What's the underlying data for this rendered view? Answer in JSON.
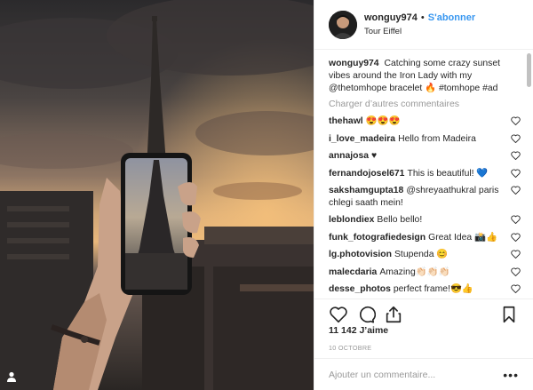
{
  "header": {
    "username": "wonguy974",
    "separator": "•",
    "follow_label": "S'abonner",
    "location": "Tour Eiffel"
  },
  "caption": {
    "username": "wonguy974",
    "text": "Catching some crazy sunset vibes around the Iron Lady with my @thetomhope bracelet 🔥 #tomhope #ad"
  },
  "load_more_label": "Charger d’autres commentaires",
  "comments": [
    {
      "username": "thehawl",
      "text": "😍😍😍"
    },
    {
      "username": "i_love_madeira",
      "text": "Hello from Madeira"
    },
    {
      "username": "annajosa",
      "text": "♥"
    },
    {
      "username": "fernandojosel671",
      "text": "This is beautiful! 💙"
    },
    {
      "username": "sakshamgupta18",
      "text": "@shreyaathukral paris chlegi saath mein!"
    },
    {
      "username": "leblondiex",
      "text": "Bello bello!"
    },
    {
      "username": "funk_fotografiedesign",
      "text": "Great Idea 📸👍"
    },
    {
      "username": "lg.photovision",
      "text": "Stupenda 😊"
    },
    {
      "username": "malecdaria",
      "text": "Amazing👏🏻👏🏻👏🏻"
    },
    {
      "username": "desse_photos",
      "text": "perfect frame!😎👍"
    }
  ],
  "likes_label": "11 142 J’aime",
  "date_label": "10 OCTOBRE",
  "add_comment_placeholder": "Ajouter un commentaire...",
  "more_label": "•••",
  "icons": {
    "like": "heart-icon",
    "comment": "comment-icon",
    "share": "share-icon",
    "save": "bookmark-icon",
    "comment_like": "heart-outline-icon",
    "photo_tag": "user-tag-icon"
  },
  "colors": {
    "follow": "#3897f0",
    "muted": "#999999",
    "text": "#262626",
    "divider": "#efefef"
  }
}
